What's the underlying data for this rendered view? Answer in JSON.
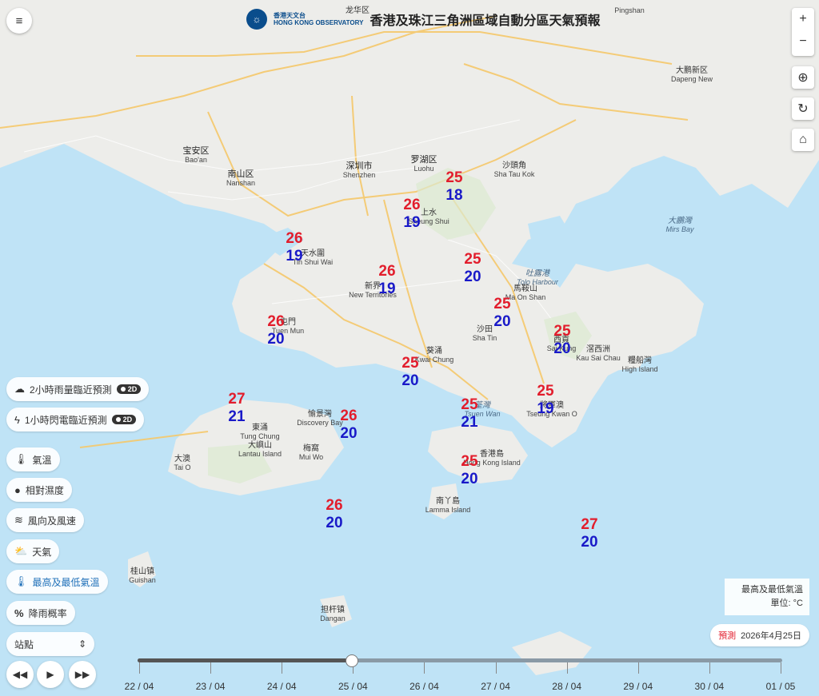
{
  "header": {
    "logo_text_zh": "香港天文台",
    "logo_text_en": "HONG KONG OBSERVATORY",
    "title": "香港及珠江三角洲區域自動分區天氣預報"
  },
  "controls": {
    "zoom_in": "+",
    "zoom_out": "−",
    "locate_icon": "crosshair-icon",
    "refresh_icon": "refresh-icon",
    "home_icon": "home-icon",
    "menu_icon": "menu-icon"
  },
  "layers": [
    {
      "label": "2小時雨量臨近預測",
      "badge": "2D",
      "icon": "rain-cloud-icon"
    },
    {
      "label": "1小時閃電臨近預測",
      "badge": "2D",
      "icon": "lightning-icon"
    },
    {
      "label": "氣溫",
      "icon": "thermometer-icon"
    },
    {
      "label": "相對濕度",
      "icon": "droplet-icon"
    },
    {
      "label": "風向及風速",
      "icon": "wind-icon"
    },
    {
      "label": "天氣",
      "icon": "weather-icon"
    },
    {
      "label": "最高及最低氣溫",
      "icon": "max-min-thermometer-icon",
      "active": true
    },
    {
      "label": "降雨概率",
      "icon": "percent-icon"
    }
  ],
  "station_select": {
    "value": "站點"
  },
  "legend": {
    "title": "最高及最低氣溫",
    "unit": "單位: °C"
  },
  "forecast": {
    "label": "預測",
    "date": "2026年4月25日"
  },
  "timeline": {
    "dates": [
      "22 / 04",
      "23 / 04",
      "24 / 04",
      "25 / 04",
      "26 / 04",
      "27 / 04",
      "28 / 04",
      "29 / 04",
      "30 / 04",
      "01 / 05"
    ],
    "selected": "25 / 04"
  },
  "places": [
    {
      "zh": "龙华区",
      "en": ""
    },
    {
      "zh": "",
      "en": "Pingshan"
    },
    {
      "zh": "大鹏新区",
      "en": "Dapeng New"
    },
    {
      "zh": "宝安区",
      "en": "Bao'an"
    },
    {
      "zh": "南山区",
      "en": "Nanshan"
    },
    {
      "zh": "深圳市",
      "en": "Shenzhen"
    },
    {
      "zh": "罗湖区",
      "en": "Luohu"
    },
    {
      "zh": "沙頭角",
      "en": "Sha Tau Kok"
    },
    {
      "zh": "大鵬灣",
      "en": "Mirs Bay"
    },
    {
      "zh": "吐露港",
      "en": "Tolo Harbour"
    },
    {
      "zh": "馬鞍山",
      "en": "Ma On Shan"
    },
    {
      "zh": "沙田",
      "en": "Sha Tin"
    },
    {
      "zh": "葵涌",
      "en": "Kwai Chung"
    },
    {
      "zh": "荃灣",
      "en": "Tsuen Wan"
    },
    {
      "zh": "新界",
      "en": "New Territories"
    },
    {
      "zh": "天水圍",
      "en": "Tin Shui Wai"
    },
    {
      "zh": "屯門",
      "en": "Tuen Mun"
    },
    {
      "zh": "上水",
      "en": "Sheung Shui"
    },
    {
      "zh": "將軍澳",
      "en": "Tseung Kwan O"
    },
    {
      "zh": "西貢",
      "en": "Sai Kung"
    },
    {
      "zh": "滘西洲",
      "en": "Kau Sai Chau"
    },
    {
      "zh": "糧船灣",
      "en": "High Island"
    },
    {
      "zh": "愉景灣",
      "en": "Discovery Bay"
    },
    {
      "zh": "東涌",
      "en": "Tung Chung"
    },
    {
      "zh": "大嶼山",
      "en": "Lantau Island"
    },
    {
      "zh": "梅窩",
      "en": "Mui Wo"
    },
    {
      "zh": "大澳",
      "en": "Tai O"
    },
    {
      "zh": "香港島",
      "en": "Hong Kong Island"
    },
    {
      "zh": "南丫島",
      "en": "Lamma Island"
    },
    {
      "zh": "桂山镇",
      "en": "Guishan"
    },
    {
      "zh": "担杆镇",
      "en": "Dangan"
    }
  ],
  "temperatures": [
    {
      "hi": "25",
      "lo": "18"
    },
    {
      "hi": "26",
      "lo": "19"
    },
    {
      "hi": "26",
      "lo": "19"
    },
    {
      "hi": "26",
      "lo": "19"
    },
    {
      "hi": "25",
      "lo": "20"
    },
    {
      "hi": "25",
      "lo": "20"
    },
    {
      "hi": "26",
      "lo": "20"
    },
    {
      "hi": "25",
      "lo": "20"
    },
    {
      "hi": "25",
      "lo": "20"
    },
    {
      "hi": "25",
      "lo": "19"
    },
    {
      "hi": "27",
      "lo": "21"
    },
    {
      "hi": "26",
      "lo": "20"
    },
    {
      "hi": "25",
      "lo": "21"
    },
    {
      "hi": "25",
      "lo": "20"
    },
    {
      "hi": "26",
      "lo": "20"
    },
    {
      "hi": "27",
      "lo": "20"
    }
  ]
}
